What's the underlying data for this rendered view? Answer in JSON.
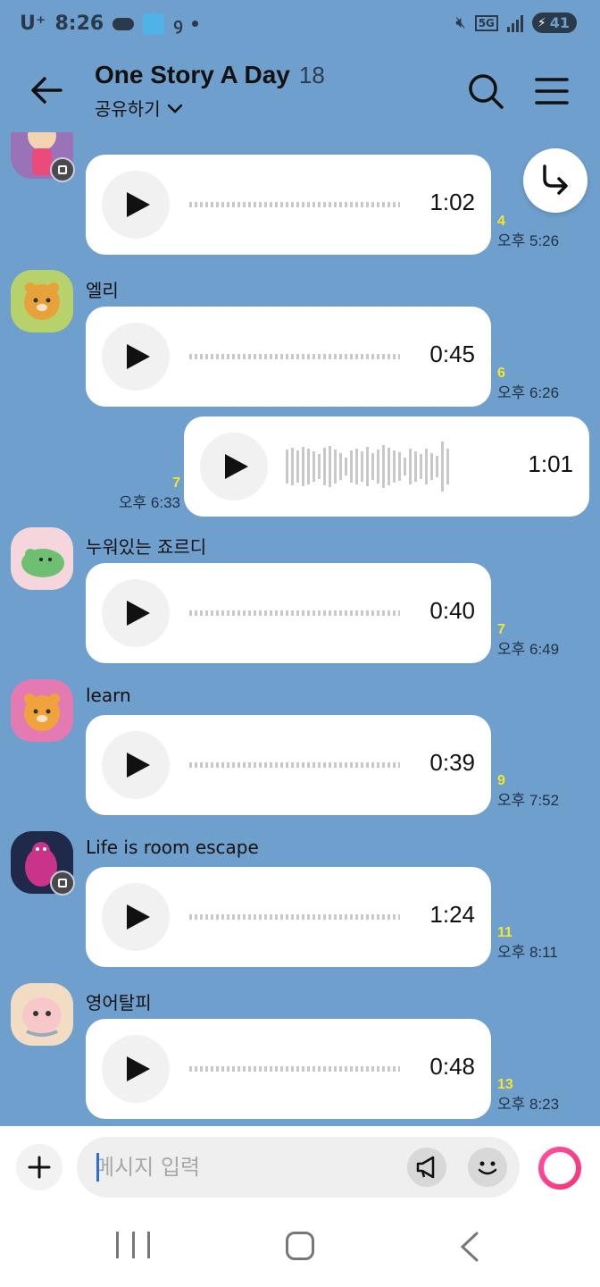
{
  "status_bar": {
    "carrier": "U⁺",
    "time": "8:26",
    "network": "5G",
    "battery": "41"
  },
  "header": {
    "title": "One Story A Day",
    "member_count": "18",
    "share_label": "공유하기"
  },
  "messages": [
    {
      "sender": "",
      "duration": "1:02",
      "unread": "4",
      "time": "오후 5:26",
      "waveform": "flat",
      "has_badge": true
    },
    {
      "sender": "엘리",
      "duration": "0:45",
      "unread": "6",
      "time": "오후 6:26",
      "waveform": "flat",
      "has_badge": false
    },
    {
      "sender": "me",
      "duration": "1:01",
      "unread": "7",
      "time": "오후 6:33",
      "waveform": "bars",
      "has_badge": false
    },
    {
      "sender": "누워있는 죠르디",
      "duration": "0:40",
      "unread": "7",
      "time": "오후 6:49",
      "waveform": "flat",
      "has_badge": false
    },
    {
      "sender": "learn",
      "duration": "0:39",
      "unread": "9",
      "time": "오후 7:52",
      "waveform": "flat",
      "has_badge": false
    },
    {
      "sender": "Life is room escape",
      "duration": "1:24",
      "unread": "11",
      "time": "오후 8:11",
      "waveform": "flat",
      "has_badge": true
    },
    {
      "sender": "영어탈피",
      "duration": "0:48",
      "unread": "13",
      "time": "오후 8:23",
      "waveform": "flat",
      "has_badge": false
    }
  ],
  "input": {
    "placeholder": "메시지 입력"
  },
  "colors": {
    "chat_background": "#6f9fcc",
    "unread_count": "#f3e62c",
    "send_ring": "#f5357a"
  },
  "icons": {
    "back": "arrow-left-icon",
    "search": "search-icon",
    "menu": "hamburger-menu-icon",
    "scroll_down": "arrow-turn-down-right-icon",
    "attach": "plus-icon",
    "megaphone": "megaphone-icon",
    "emoji": "smiley-icon",
    "send": "send-ring-icon"
  }
}
